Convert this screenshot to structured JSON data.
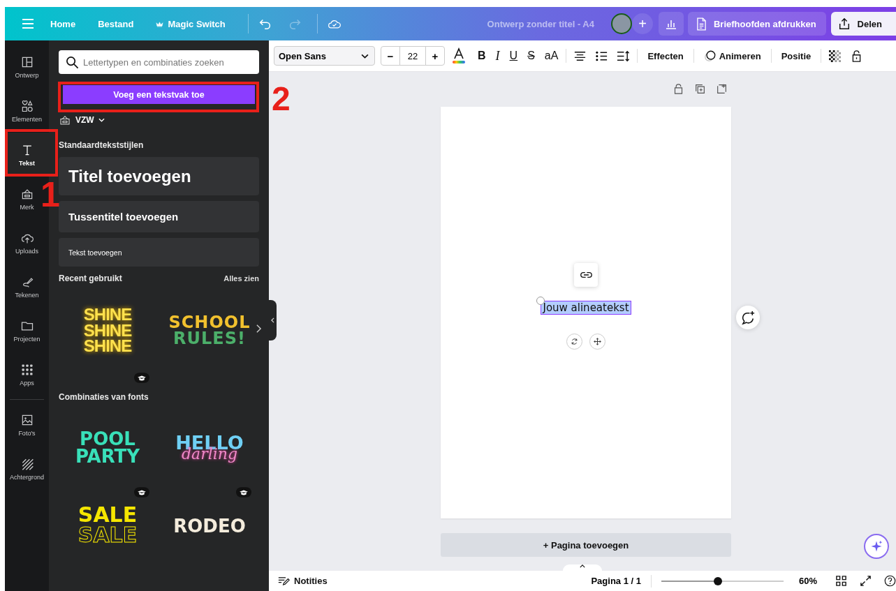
{
  "header": {
    "menu": [
      {
        "label": "Home",
        "kind": "plain"
      },
      {
        "label": "Bestand",
        "kind": "plain"
      },
      {
        "label": "Magic Switch",
        "kind": "crown"
      }
    ],
    "redo_disabled": true,
    "title": "Ontwerp zonder titel - A4",
    "add": "+",
    "print_button": "Briefhoofden afdrukken",
    "share_button": "Delen"
  },
  "rail": [
    {
      "label": "Ontwerp",
      "selected": false
    },
    {
      "label": "Elementen",
      "selected": false
    },
    {
      "label": "Tekst",
      "selected": true
    },
    {
      "label": "Merk",
      "selected": false
    },
    {
      "label": "Uploads",
      "selected": false
    },
    {
      "label": "Tekenen",
      "selected": false
    },
    {
      "label": "Projecten",
      "selected": false
    },
    {
      "label": "Apps",
      "selected": false
    },
    {
      "label": "Foto's",
      "selected": false
    },
    {
      "label": "Achtergrond",
      "selected": false
    }
  ],
  "panel": {
    "search": {
      "placeholder": "Lettertypen en combinaties zoeken"
    },
    "add_textbox": "Voeg een tekstvak toe",
    "brand": "VZW",
    "styles_heading": "Standaardtekststijlen",
    "styles": [
      {
        "label": "Titel toevoegen",
        "kind": "title"
      },
      {
        "label": "Tussentitel toevoegen",
        "kind": "subtitle"
      },
      {
        "label": "Tekst toevoegen",
        "kind": "body"
      }
    ],
    "recent_heading": "Recent gebruikt",
    "see_all": "Alles zien",
    "recent": [
      {
        "kind": "neon",
        "lines": [
          "SHINE",
          "SHINE",
          "SHINE"
        ],
        "premium": true
      },
      {
        "kind": "hand",
        "lines": [
          "SCHOOL",
          "RULES!"
        ],
        "premium": false
      }
    ],
    "combos_heading": "Combinaties van fonts",
    "combos": [
      {
        "kind": "pool",
        "lines": [
          "POOL",
          "PARTY"
        ],
        "premium": true
      },
      {
        "kind": "hello",
        "lines": [
          "HELLO",
          "darling"
        ],
        "premium": true
      },
      {
        "kind": "sale",
        "lines": [
          "SALE",
          "SALE"
        ],
        "premium": false
      },
      {
        "kind": "rodeo",
        "lines": [
          "RODEO"
        ],
        "premium": false
      }
    ]
  },
  "toolbar": {
    "font": "Open Sans",
    "minus": "−",
    "size": "22",
    "plus": "+",
    "bold": "B",
    "italic": "I",
    "underline": "U",
    "strike": "S",
    "case": "aA",
    "effects": "Effecten",
    "animate": "Animeren",
    "position": "Positie"
  },
  "canvas": {
    "text": "Jouw alineatekst",
    "add_page": "+ Pagina toevoegen"
  },
  "footer": {
    "notes": "Notities",
    "page": "Pagina 1 / 1",
    "zoom": {
      "level": 0.46
    },
    "zoom_label": "60%"
  },
  "annotations": [
    {
      "label": "1"
    },
    {
      "label": "2"
    }
  ]
}
